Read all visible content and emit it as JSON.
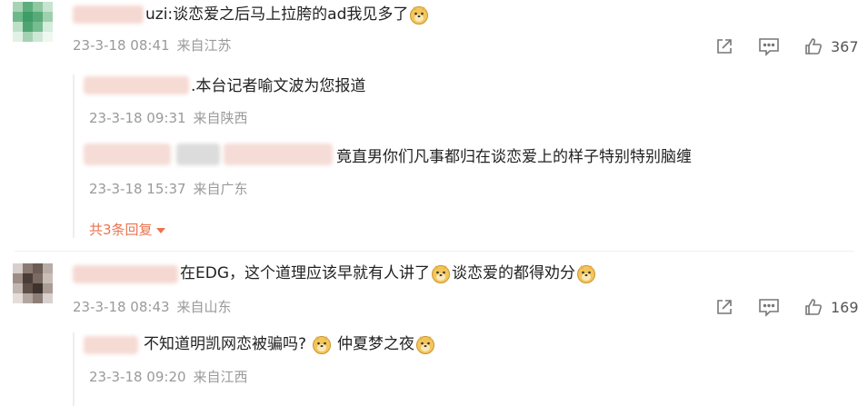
{
  "comments": [
    {
      "text_before": "uzi:谈恋爱之后马上拉胯的ad我见多了",
      "text_after": "",
      "time": "23-3-18 08:41",
      "location": "来自江苏",
      "likes": "367",
      "replies": [
        {
          "text": ".本台记者喻文波为您报道",
          "time": "23-3-18 09:31",
          "location": "来自陕西"
        },
        {
          "text": "竟直男你们凡事都归在谈恋爱上的样子特别特别脑缠",
          "time": "23-3-18 15:37",
          "location": "来自广东"
        }
      ],
      "more_replies": "共3条回复"
    },
    {
      "text_before": "在EDG，这个道理应该早就有人讲了",
      "text_after": "谈恋爱的都得劝分",
      "time": "23-3-18 08:43",
      "location": "来自山东",
      "likes": "169",
      "replies": [
        {
          "text_before": "不知道明凯网恋被骗吗?",
          "text_after": "仲夏梦之夜",
          "time": "23-3-18 09:20",
          "location": "来自江西"
        }
      ]
    }
  ],
  "icons": {
    "share": "share-icon",
    "comment": "comment-icon",
    "like": "like-icon",
    "emoji": "doge-emoji-icon"
  },
  "colors": {
    "accent": "#eb7350",
    "meta": "#9a9a9a"
  }
}
